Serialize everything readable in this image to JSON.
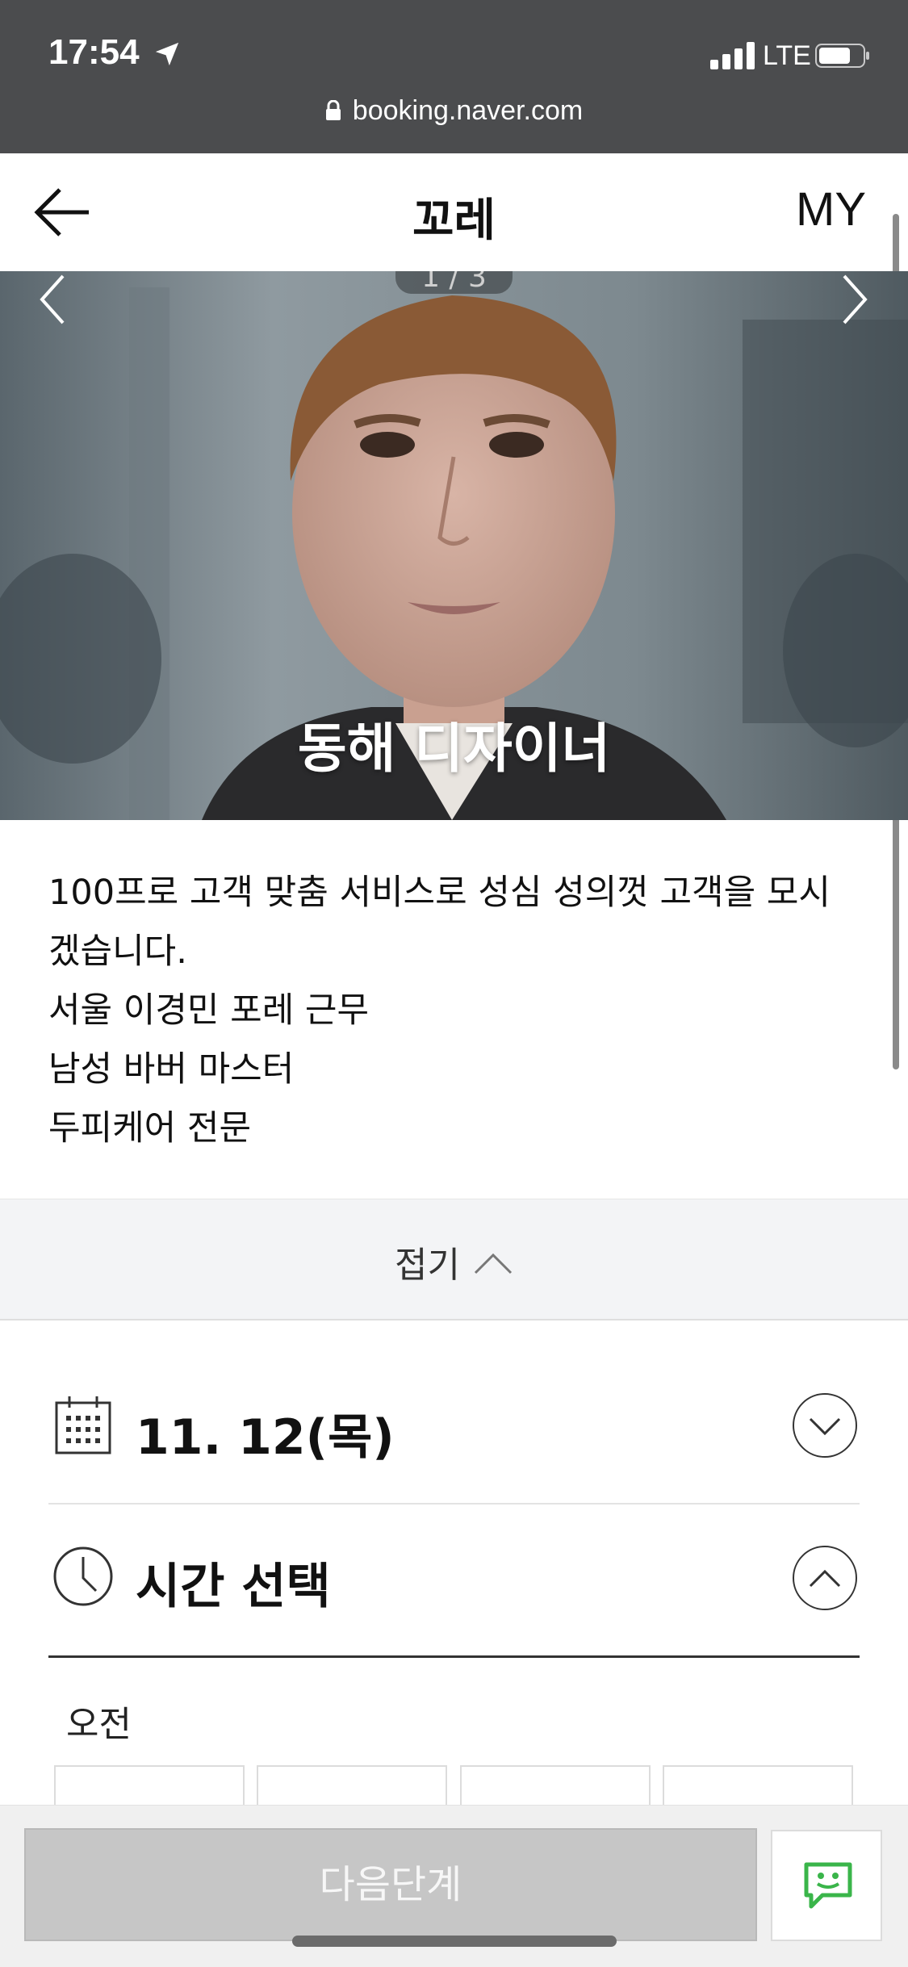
{
  "status_bar": {
    "time": "17:54",
    "network": "LTE",
    "url": "booking.naver.com"
  },
  "header": {
    "title": "꼬레",
    "right_label": "MY"
  },
  "gallery": {
    "counter": "1 / 3",
    "designer_name": "동해 디자이너"
  },
  "description": {
    "lines": [
      "100프로 고객 맞춤 서비스로 성심 성의껏 고객을 모시",
      "겠습니다.",
      "서울 이경민 포레 근무",
      "남성 바버 마스터",
      "두피케어 전문"
    ]
  },
  "fold": {
    "label": "접기"
  },
  "date_section": {
    "date": "11. 12(목)"
  },
  "time_section": {
    "label": "시간 선택",
    "period_am": "오전"
  },
  "bottom": {
    "next_label": "다음단계"
  },
  "colors": {
    "talk_green": "#3ab54a",
    "status_bar_bg": "#4b4c4e",
    "next_disabled": "#c6c6c6"
  },
  "icons": [
    "location-arrow-icon",
    "signal-icon",
    "battery-icon",
    "lock-icon",
    "back-arrow-icon",
    "chevron-left-icon",
    "chevron-right-icon",
    "chevron-up-icon",
    "calendar-icon",
    "clock-icon",
    "chevron-down-icon",
    "talk-icon"
  ]
}
